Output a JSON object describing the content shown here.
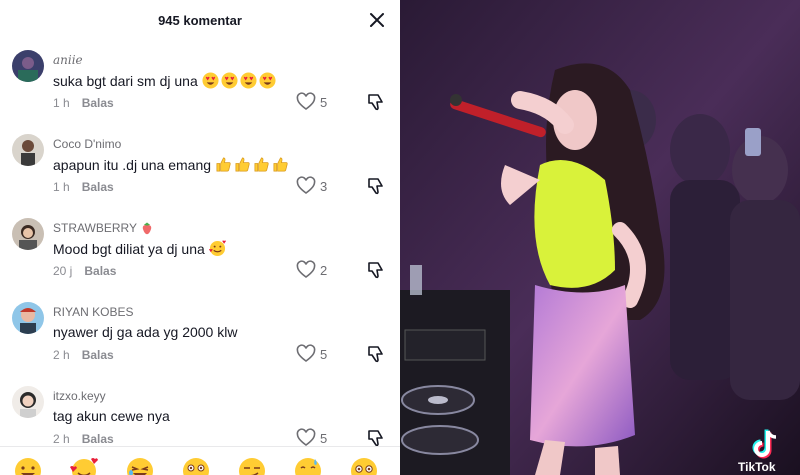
{
  "comments_panel": {
    "title": "945 komentar",
    "reply_label": "Balas",
    "comments": [
      {
        "username": "aniie",
        "text": "suka bgt dari sm dj una",
        "emojis": [
          "heart-eyes",
          "heart-eyes",
          "heart-eyes",
          "heart-eyes"
        ],
        "time": "1 h",
        "likes": "5"
      },
      {
        "username": "Coco D'nimo",
        "text": "apapun itu .dj una emang",
        "emojis": [
          "thumbs-up",
          "thumbs-up",
          "thumbs-up",
          "thumbs-up"
        ],
        "time": "1 h",
        "likes": "3"
      },
      {
        "username": "STRAWBERRY",
        "username_emoji": "strawberry",
        "text": "Mood bgt diliat ya dj una",
        "emojis": [
          "smiling-face-with-hearts"
        ],
        "time": "20 j",
        "likes": "2"
      },
      {
        "username": "RIYAN KOBES",
        "text": "nyawer dj ga ada yg 2000 klw",
        "emojis": [],
        "time": "2 h",
        "likes": "5"
      },
      {
        "username": "itzxo.keyy",
        "text": "tag akun cewe nya",
        "emojis": [],
        "time": "2 h",
        "likes": "5"
      }
    ],
    "emoji_bar": [
      "grin-emoji",
      "smiling-face-with-hearts",
      "laughing-emoji",
      "wow-emoji",
      "smirk-emoji",
      "sweat-smile-emoji",
      "flushed-emoji"
    ]
  },
  "video": {
    "watermark": "TikTok"
  },
  "colors": {
    "accent_dark": "#161823",
    "muted": "#8a8b91",
    "emoji_yellow": "#ffcc33"
  }
}
